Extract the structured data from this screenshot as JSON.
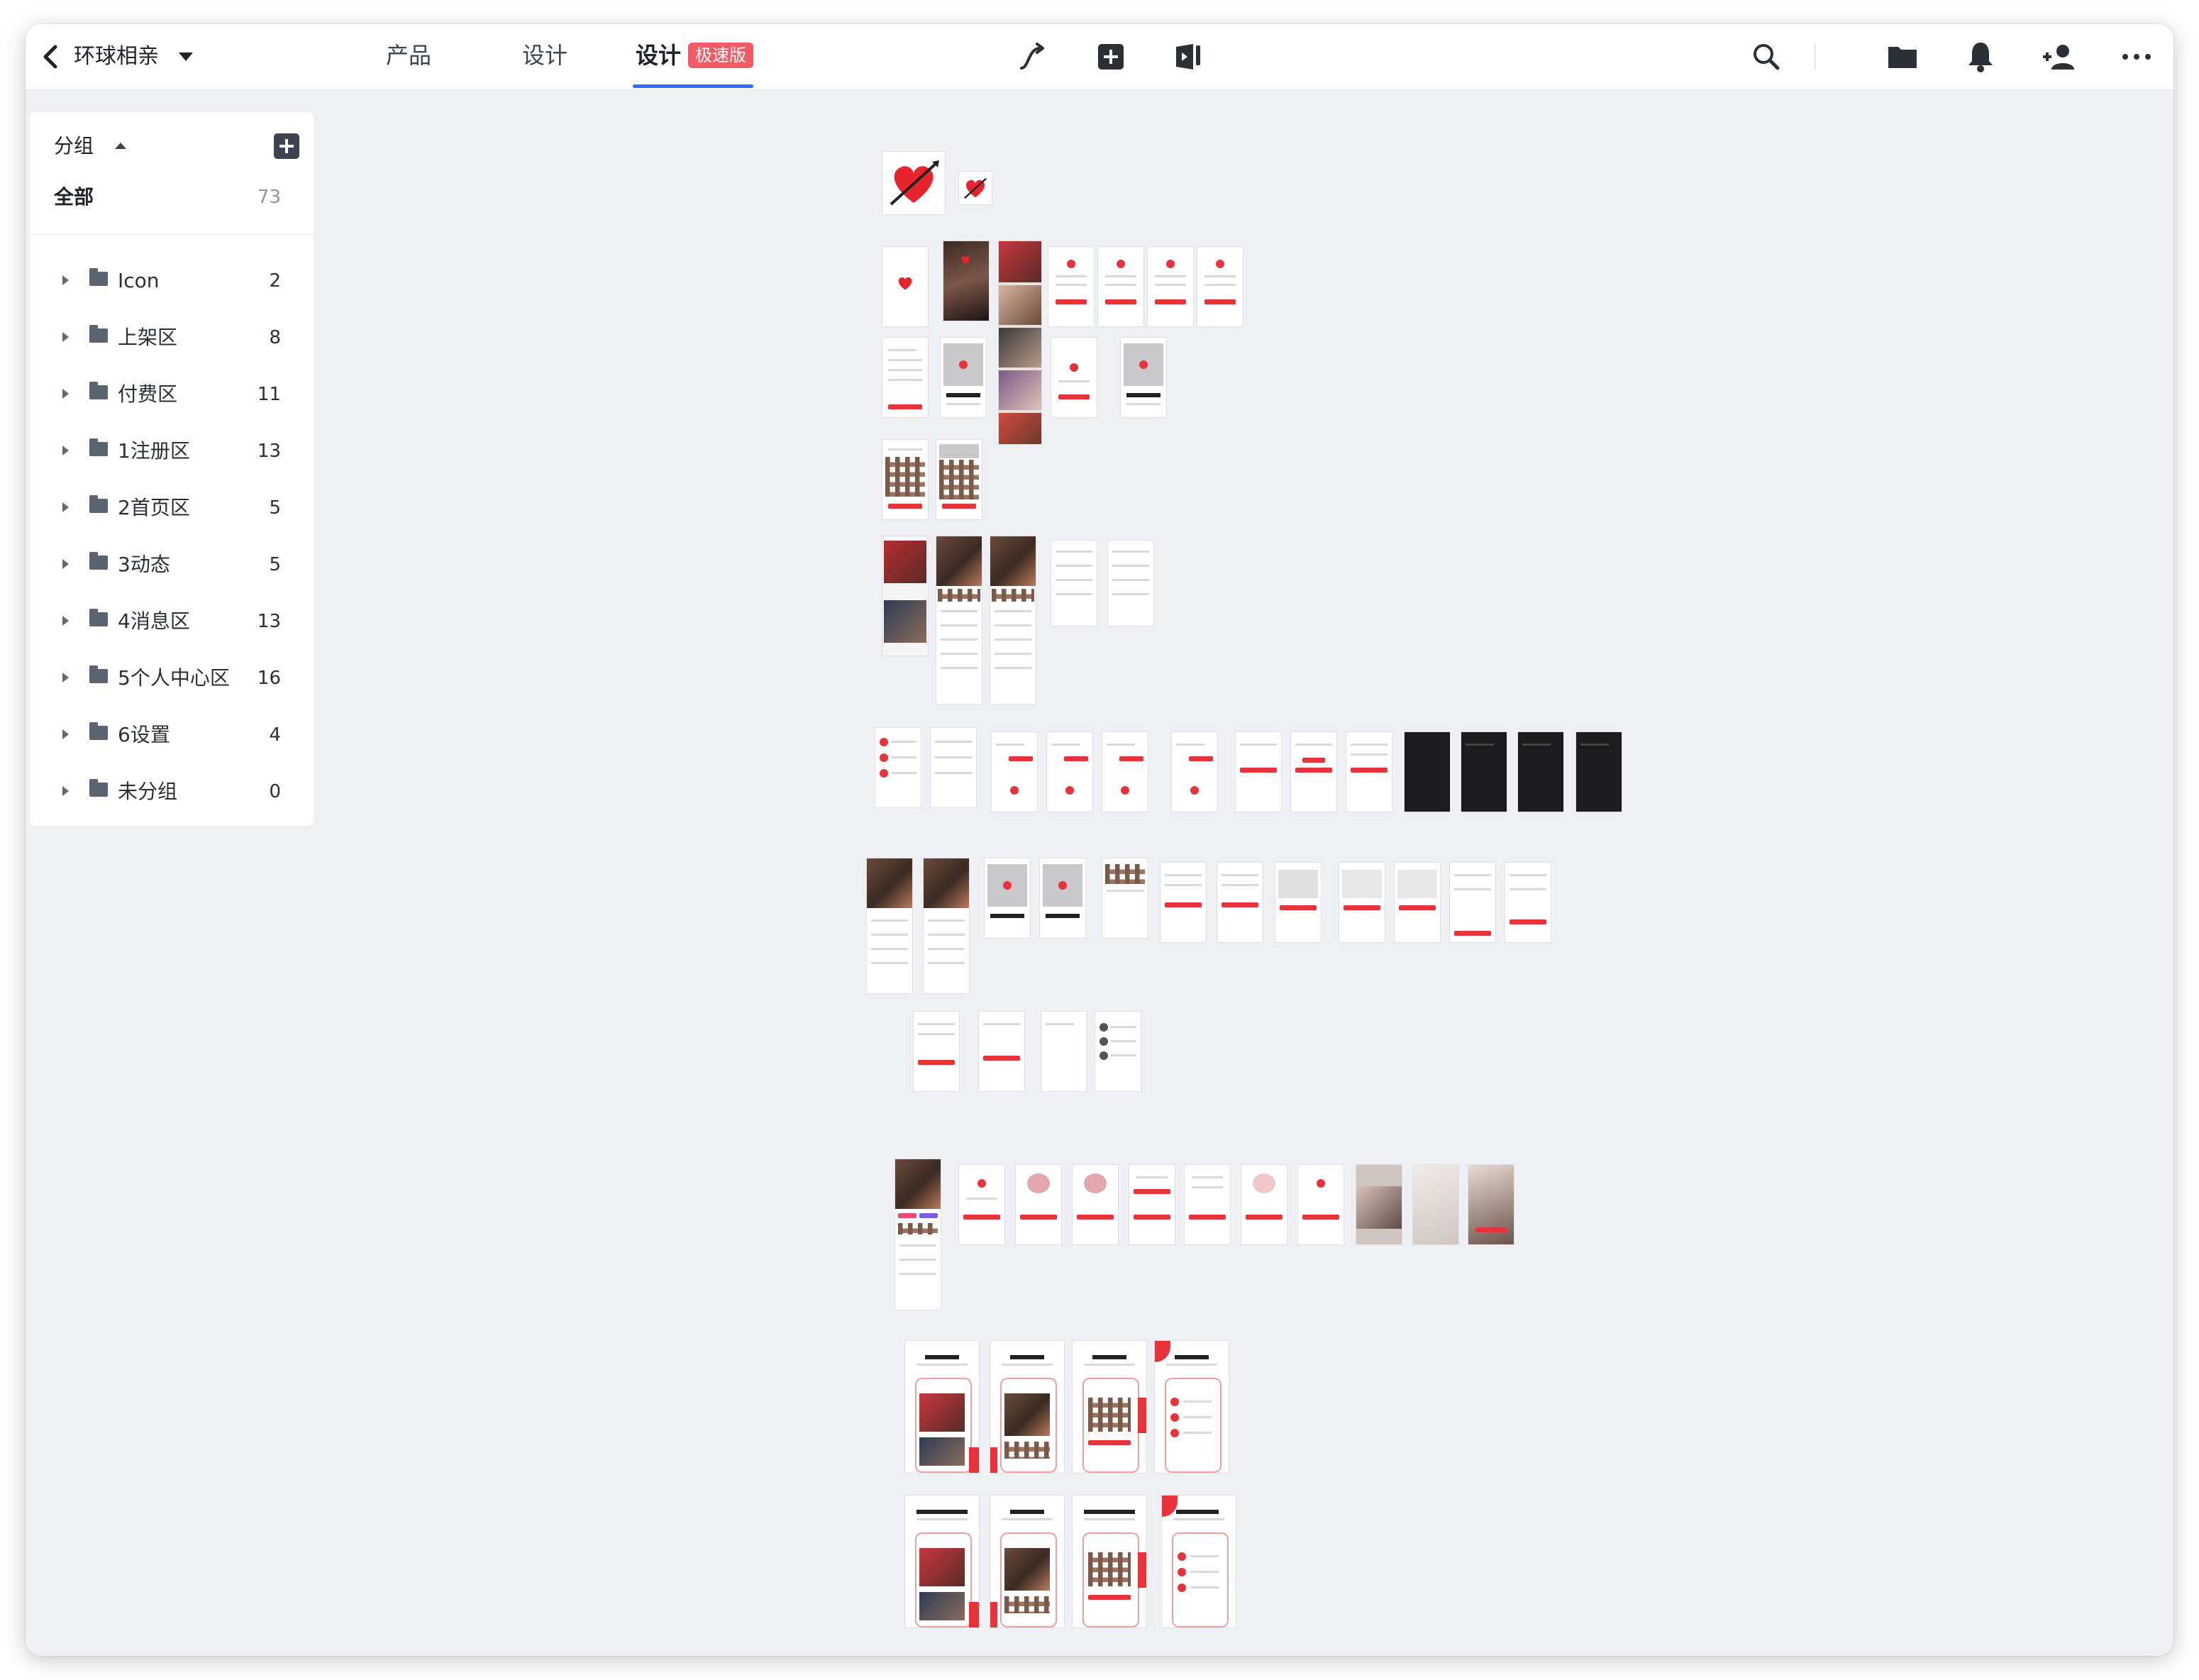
{
  "toolbar": {
    "project_name": "环球相亲",
    "tabs": [
      {
        "label": "产品"
      },
      {
        "label": "设计"
      },
      {
        "label": "设计",
        "badge": "极速版",
        "active": true
      }
    ]
  },
  "sidebar": {
    "header": "分组",
    "all_label": "全部",
    "all_count": "73",
    "groups": [
      {
        "name": "Icon",
        "count": "2"
      },
      {
        "name": "上架区",
        "count": "8"
      },
      {
        "name": "付费区",
        "count": "11"
      },
      {
        "name": "1注册区",
        "count": "13"
      },
      {
        "name": "2首页区",
        "count": "5"
      },
      {
        "name": "3动态",
        "count": "5"
      },
      {
        "name": "4消息区",
        "count": "13"
      },
      {
        "name": "5个人中心区",
        "count": "16"
      },
      {
        "name": "6设置",
        "count": "4"
      },
      {
        "name": "未分组",
        "count": "0"
      }
    ]
  },
  "colors": {
    "accent": "#2f6bff",
    "badge": "#f25b66",
    "brand_red": "#e8333b"
  },
  "icons": [
    "back-icon",
    "caret-down-icon",
    "connector-icon",
    "add-square-icon",
    "preview-icon",
    "search-icon",
    "folder-icon",
    "bell-icon",
    "add-user-icon",
    "more-icon"
  ]
}
